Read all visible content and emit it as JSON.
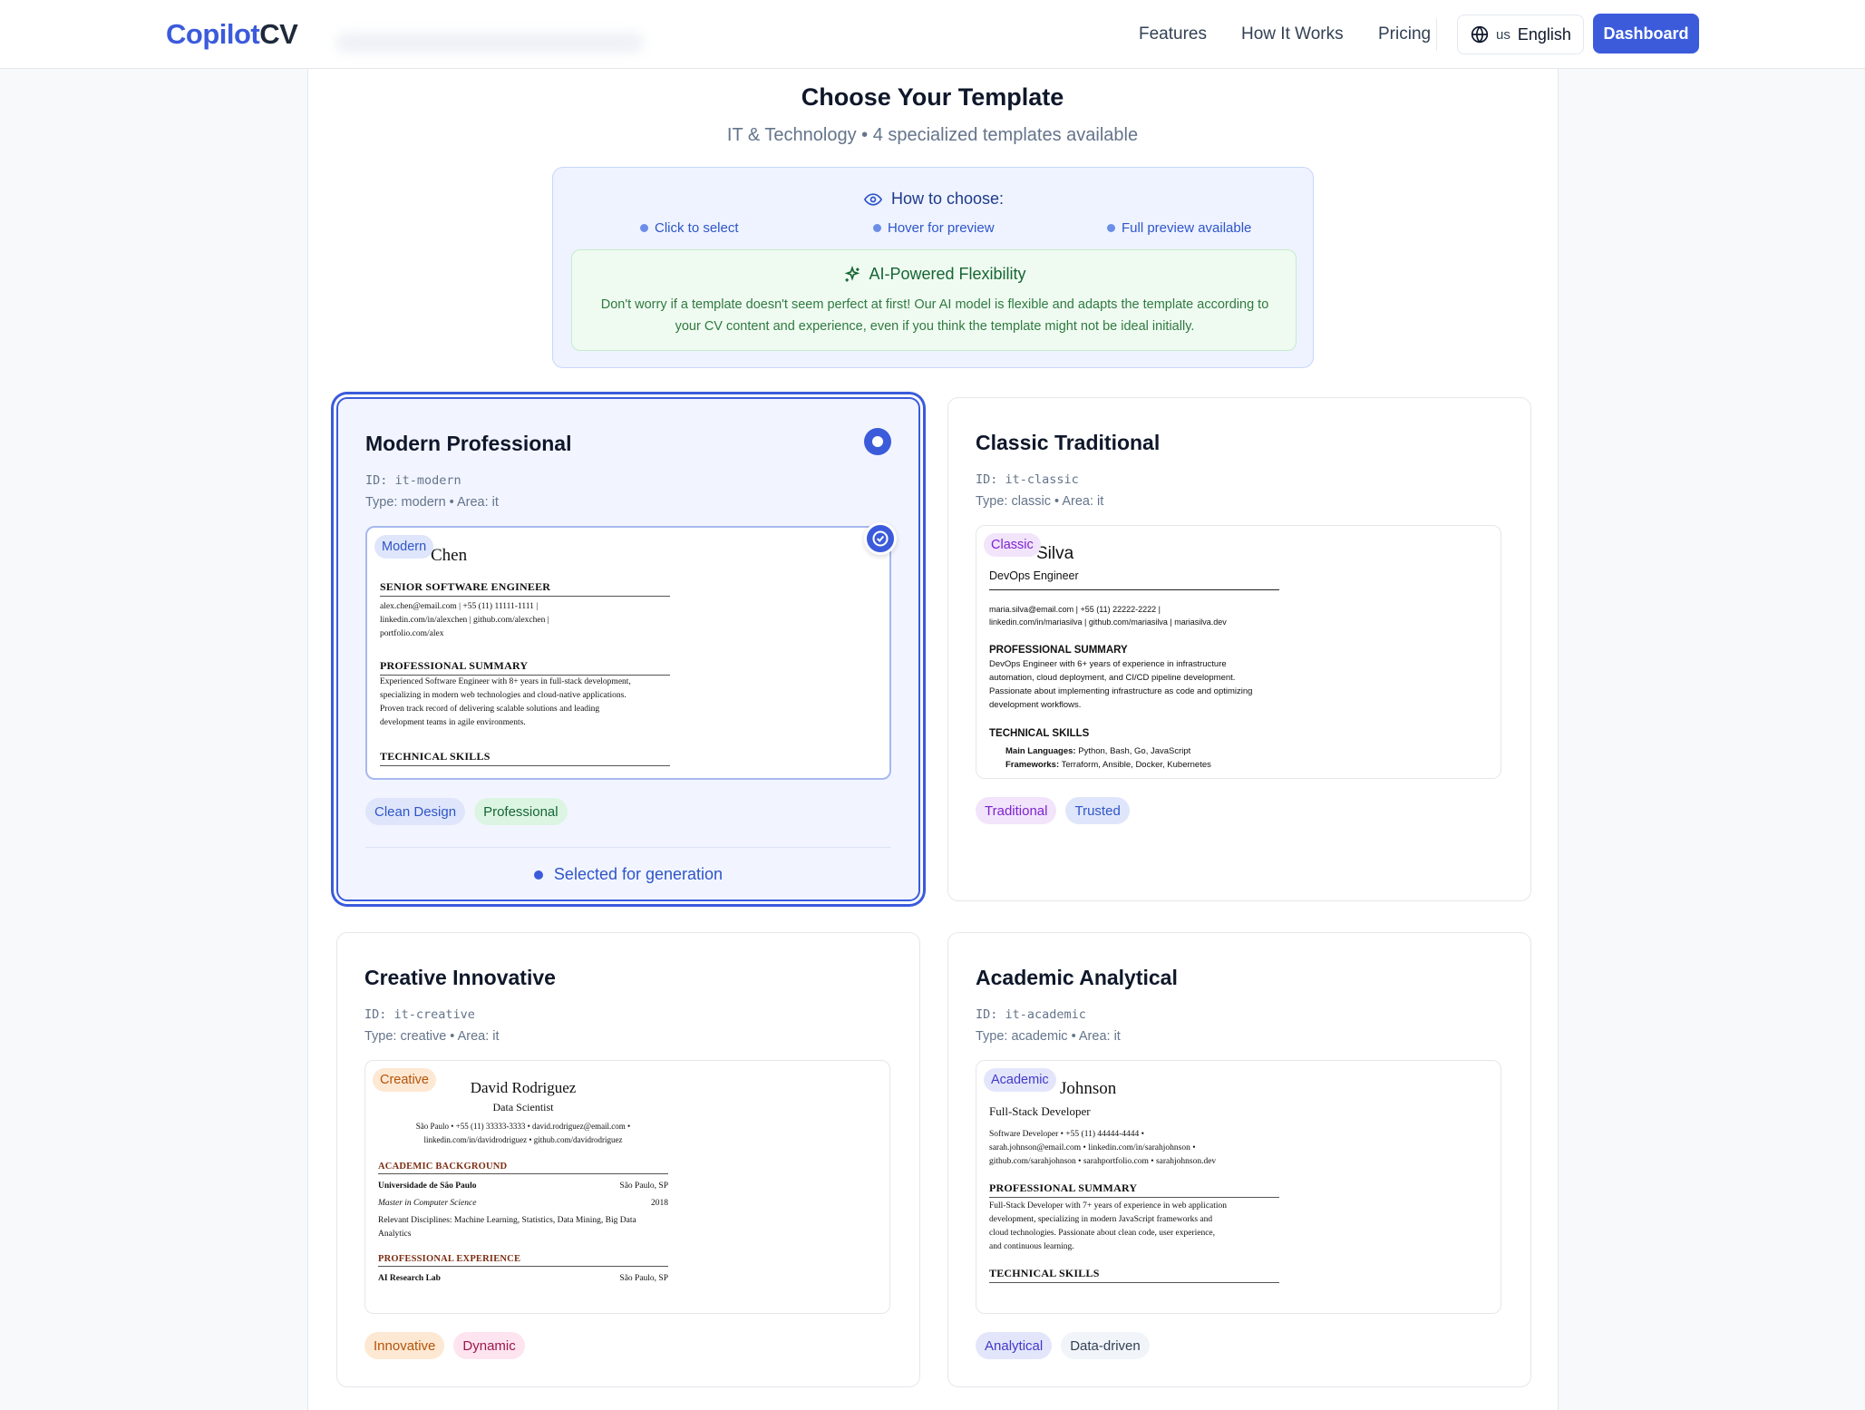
{
  "header": {
    "logo_part1": "Copilot",
    "logo_part2": "CV",
    "nav": [
      "Features",
      "How It Works",
      "Pricing"
    ],
    "language_flag": "us",
    "language_label": "English",
    "dashboard_label": "Dashboard"
  },
  "page": {
    "title": "Choose Your Template",
    "subtitle": "IT & Technology • 4 specialized templates available"
  },
  "howto": {
    "title": "How to choose:",
    "steps": [
      "Click to select",
      "Hover for preview",
      "Full preview available"
    ],
    "ai_title": "AI-Powered Flexibility",
    "ai_text": "Don't worry if a template doesn't seem perfect at first! Our AI model is flexible and adapts the template according to your CV content and experience, even if you think the template might not be ideal initially."
  },
  "colors": {
    "accent": "#3b5bdb",
    "accent_light": "#eef3ff",
    "success_bg": "#effbf1"
  },
  "templates": [
    {
      "title": "Modern Professional",
      "id": "ID: it-modern",
      "type": "Type: modern • Area: it",
      "tag": "Modern",
      "chips": [
        "Clean Design",
        "Professional"
      ],
      "selected_label": "Selected for generation",
      "preview": {
        "name": "Chen",
        "heading1": "SENIOR SOFTWARE ENGINEER",
        "contact": [
          "alex.chen@email.com | +55 (11) 11111-1111 |",
          "linkedin.com/in/alexchen | github.com/alexchen |",
          "portfolio.com/alex"
        ],
        "heading2": "PROFESSIONAL SUMMARY",
        "summary": [
          "Experienced Software Engineer with 8+ years in full-stack development,",
          "specializing in modern web technologies and cloud-native applications.",
          "Proven track record of delivering scalable solutions and leading",
          "development teams in agile environments."
        ],
        "heading3": "TECHNICAL SKILLS"
      }
    },
    {
      "title": "Classic Traditional",
      "id": "ID: it-classic",
      "type": "Type: classic • Area: it",
      "tag": "Classic",
      "chips": [
        "Traditional",
        "Trusted"
      ],
      "preview": {
        "name": "Silva",
        "role": "DevOps Engineer",
        "contact": [
          "maria.silva@email.com | +55 (11) 22222-2222 |",
          "linkedin.com/in/mariasilva | github.com/mariasilva | mariasilva.dev"
        ],
        "heading2": "PROFESSIONAL SUMMARY",
        "summary": [
          "DevOps Engineer with 6+ years of experience in infrastructure",
          "automation, cloud deployment, and CI/CD pipeline development.",
          "Passionate about implementing infrastructure as code and optimizing",
          "development workflows."
        ],
        "heading3": "TECHNICAL SKILLS",
        "skill1_label": "Main Languages:",
        "skill1_value": "Python, Bash, Go, JavaScript",
        "skill2_label": "Frameworks:",
        "skill2_value": "Terraform, Ansible, Docker, Kubernetes"
      }
    },
    {
      "title": "Creative Innovative",
      "id": "ID: it-creative",
      "type": "Type: creative • Area: it",
      "tag": "Creative",
      "chips": [
        "Innovative",
        "Dynamic"
      ],
      "preview": {
        "name": "David Rodriguez",
        "role": "Data Scientist",
        "contact": [
          "São Paulo • +55 (11) 33333-3333 • david.rodriguez@email.com •",
          "linkedin.com/in/davidrodriguez • github.com/davidrodriguez"
        ],
        "heading1": "ACADEMIC BACKGROUND",
        "school": "Universidade de São Paulo",
        "school_loc": "São Paulo, SP",
        "degree": "Master in Computer Science",
        "degree_year": "2018",
        "disciplines": [
          "Relevant Disciplines: Machine Learning, Statistics, Data Mining, Big Data",
          "Analytics"
        ],
        "heading2": "PROFESSIONAL EXPERIENCE",
        "company": "AI Research Lab",
        "company_loc": "São Paulo, SP"
      }
    },
    {
      "title": "Academic Analytical",
      "id": "ID: it-academic",
      "type": "Type: academic • Area: it",
      "tag": "Academic",
      "chips": [
        "Analytical",
        "Data-driven"
      ],
      "preview": {
        "name": "Johnson",
        "role": "Full-Stack Developer",
        "contact": [
          "Software Developer • +55 (11) 44444-4444 •",
          "sarah.johnson@email.com • linkedin.com/in/sarahjohnson •",
          "github.com/sarahjohnson • sarahportfolio.com • sarahjohnson.dev"
        ],
        "heading2": "PROFESSIONAL SUMMARY",
        "summary": [
          "Full-Stack Developer with 7+ years of experience in web application",
          "development, specializing in modern JavaScript frameworks and",
          "cloud technologies. Passionate about clean code, user experience,",
          "and continuous learning."
        ],
        "heading3": "TECHNICAL SKILLS"
      }
    }
  ]
}
